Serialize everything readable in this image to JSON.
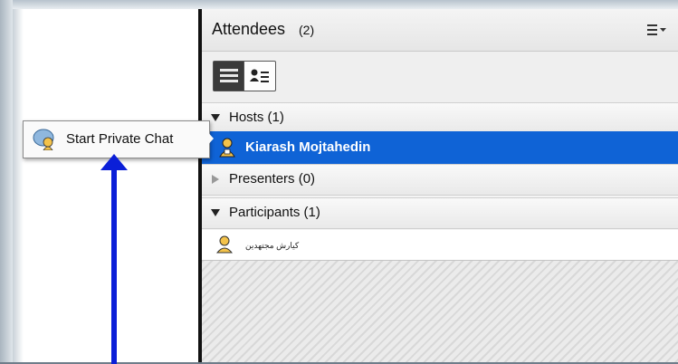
{
  "attendees_panel": {
    "title": "Attendees",
    "count": "(2)",
    "menu_icon": "list-menu-icon"
  },
  "view_toggle": {
    "list_view_icon": "list-view-icon",
    "detail_view_icon": "person-list-icon"
  },
  "sections": [
    {
      "label": "Hosts (1)",
      "expanded": true
    },
    {
      "label": "Presenters (0)",
      "expanded": false
    },
    {
      "label": "Participants (1)",
      "expanded": true
    }
  ],
  "hosts": [
    {
      "name": "Kiarash Mojtahedin",
      "selected": true,
      "icon": "host-user-icon"
    }
  ],
  "participants": [
    {
      "name": "کیارش مجتهدین",
      "icon": "participant-user-icon"
    }
  ],
  "context_menu": {
    "item_label": "Start Private Chat",
    "item_icon": "private-chat-icon"
  },
  "annotation": {
    "arrow_color": "#0b1fd8"
  },
  "colors": {
    "selection": "#0f63d6",
    "arrow": "#0b1fd8"
  }
}
